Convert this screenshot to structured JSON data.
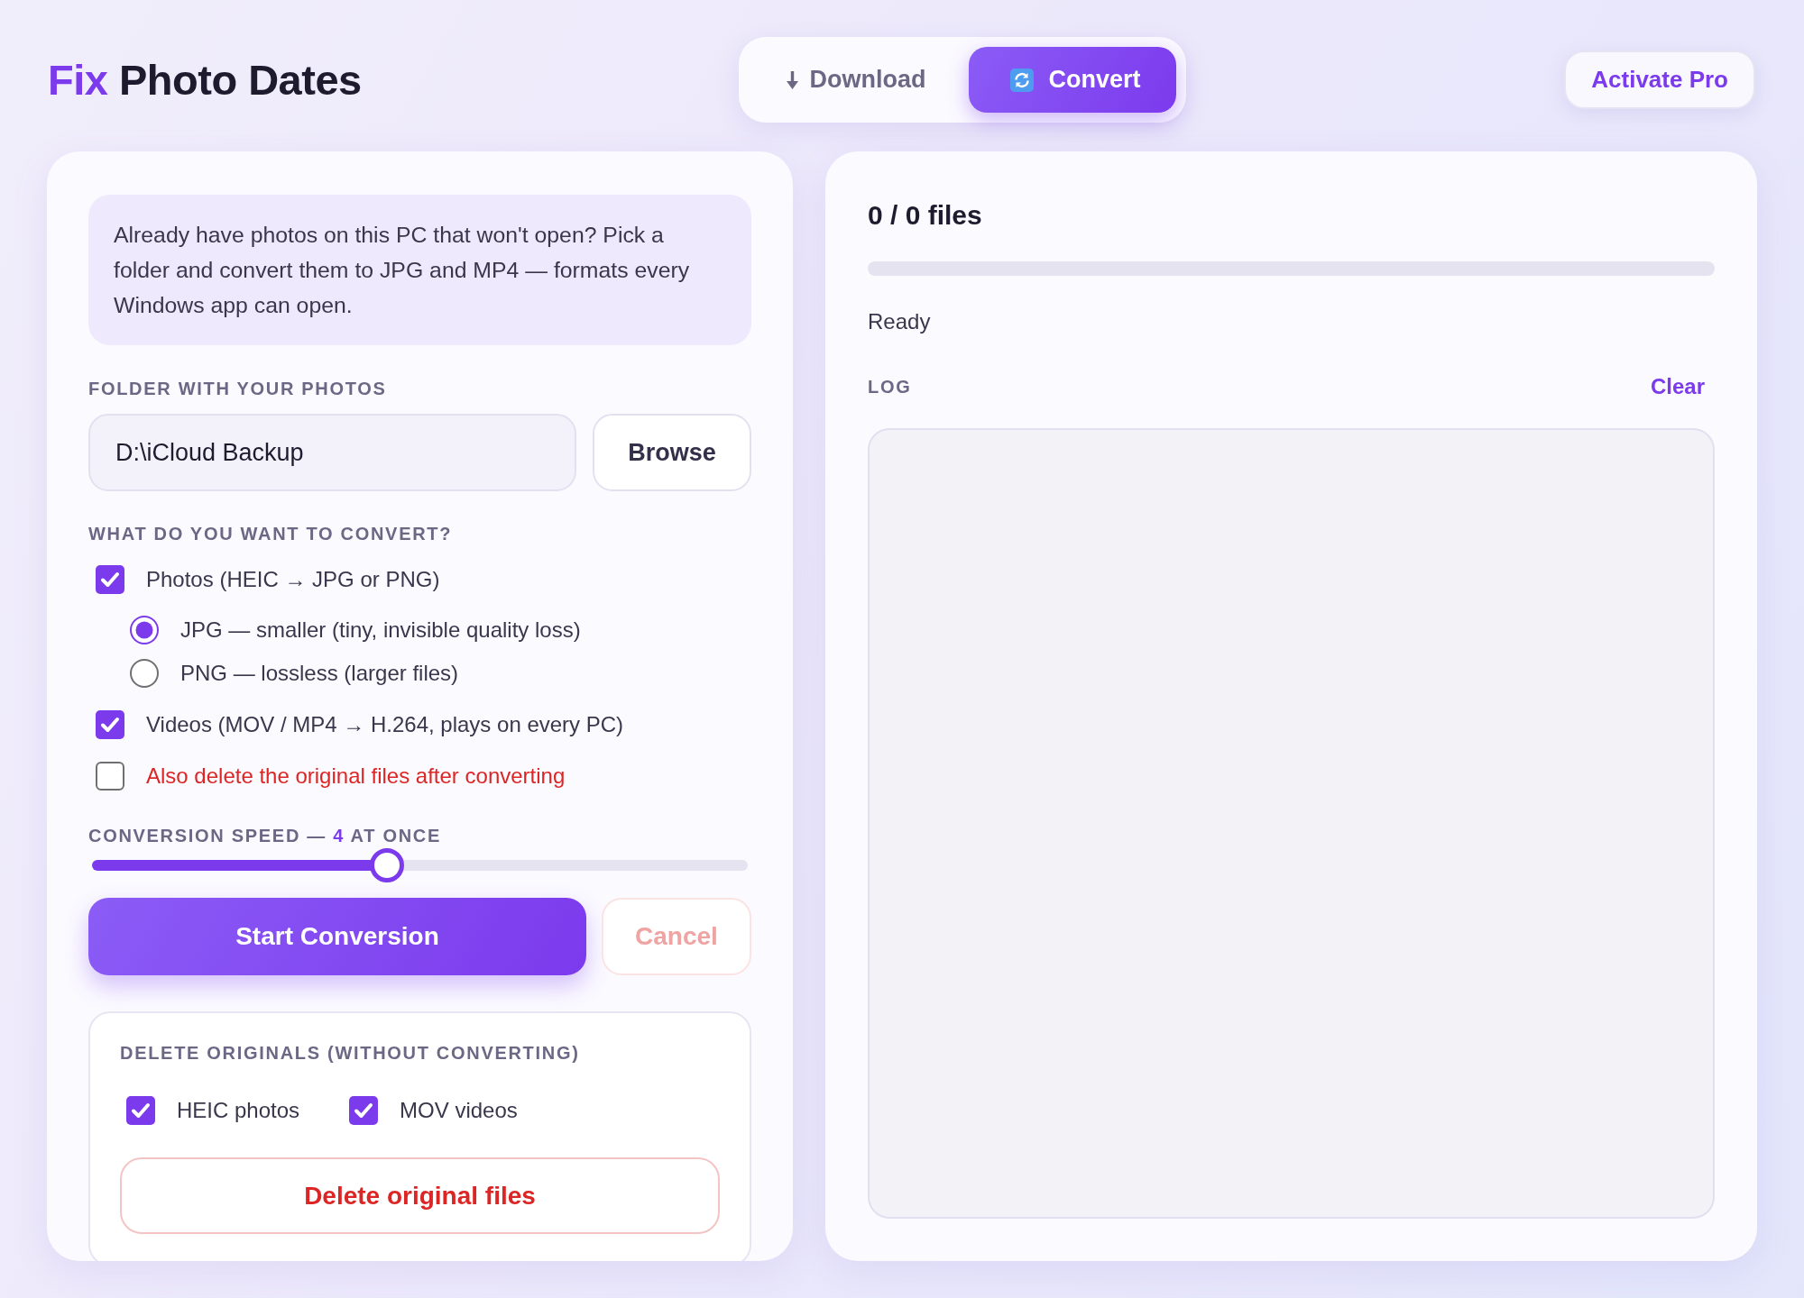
{
  "header": {
    "title_accent": "Fix",
    "title": "Photo Dates",
    "tabs": [
      {
        "label": "Download",
        "selected": false
      },
      {
        "label": "Convert",
        "selected": true
      }
    ],
    "pro_button": "Activate Pro"
  },
  "converter": {
    "intro": "Already have photos on this PC that won't open? Pick a folder and convert them to JPG and MP4 — formats every Windows app can open.",
    "folder": {
      "label": "FOLDER WITH YOUR PHOTOS",
      "value": "D:\\iCloud Backup",
      "browse_button": "Browse"
    },
    "convert": {
      "label": "WHAT DO YOU WANT TO CONVERT?",
      "options": [
        {
          "kind": "checkbox",
          "label": "Photos (HEIC → JPG or PNG)",
          "checked": true,
          "warning": false,
          "children": [
            {
              "kind": "radio",
              "label": "JPG — smaller (tiny, invisible quality loss)",
              "selected": true
            },
            {
              "kind": "radio",
              "label": "PNG — lossless (larger files)",
              "selected": false
            }
          ]
        },
        {
          "kind": "checkbox",
          "label": "Videos (MOV / MP4 → H.264, plays on every PC)",
          "checked": true,
          "warning": false
        },
        {
          "kind": "checkbox",
          "label": "Also delete the original files after converting",
          "checked": false,
          "warning": true
        }
      ]
    },
    "speed": {
      "label": "CONVERSION SPEED —",
      "value": "4",
      "unit": "AT ONCE",
      "level": 0.45
    },
    "start_button": "Start Conversion",
    "cancel_button": {
      "label": "Cancel",
      "disabled": true
    },
    "delete_originals": {
      "title": "DELETE ORIGINALS (WITHOUT CONVERTING)",
      "options": [
        {
          "label": "HEIC photos",
          "checked": true
        },
        {
          "label": "MOV videos",
          "checked": true
        }
      ],
      "button": "Delete original files"
    }
  },
  "progress": {
    "count": "0 / 0 files",
    "level": 0,
    "status": "Ready"
  },
  "log": {
    "label": "LOG",
    "clear_button": "Clear"
  }
}
